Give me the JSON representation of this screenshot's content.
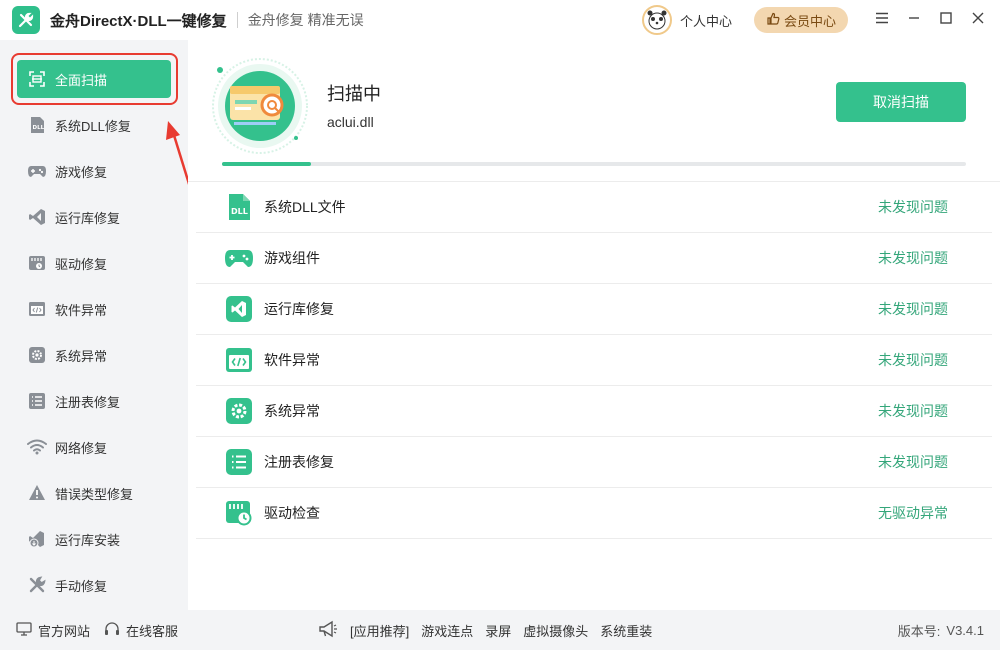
{
  "header": {
    "app_title": "金舟DirectX·DLL一键修复",
    "slogan": "金舟修复 精准无误",
    "personal_center": "个人中心",
    "vip_center": "会员中心",
    "logo_icon": "wrench-screwdriver-icon"
  },
  "sidebar": {
    "items": [
      {
        "label": "全面扫描",
        "icon": "scan-icon",
        "active": true
      },
      {
        "label": "系统DLL修复",
        "icon": "dll-icon"
      },
      {
        "label": "游戏修复",
        "icon": "gamepad-icon"
      },
      {
        "label": "运行库修复",
        "icon": "visual-studio-icon"
      },
      {
        "label": "驱动修复",
        "icon": "driver-icon"
      },
      {
        "label": "软件异常",
        "icon": "code-window-icon"
      },
      {
        "label": "系统异常",
        "icon": "gear-icon"
      },
      {
        "label": "注册表修复",
        "icon": "list-icon"
      },
      {
        "label": "网络修复",
        "icon": "wifi-icon"
      },
      {
        "label": "错误类型修复",
        "icon": "warning-icon"
      },
      {
        "label": "运行库安装",
        "icon": "install-icon"
      },
      {
        "label": "手动修复",
        "icon": "tools-icon"
      }
    ]
  },
  "scan": {
    "status": "扫描中",
    "current_file": "aclui.dll",
    "cancel_label": "取消扫描",
    "progress": 0.12
  },
  "results": [
    {
      "label": "系统DLL文件",
      "status": "未发现问题",
      "icon": "dll-icon"
    },
    {
      "label": "游戏组件",
      "status": "未发现问题",
      "icon": "gamepad-icon"
    },
    {
      "label": "运行库修复",
      "status": "未发现问题",
      "icon": "visual-studio-icon"
    },
    {
      "label": "软件异常",
      "status": "未发现问题",
      "icon": "code-window-icon"
    },
    {
      "label": "系统异常",
      "status": "未发现问题",
      "icon": "gear-icon"
    },
    {
      "label": "注册表修复",
      "status": "未发现问题",
      "icon": "list-icon"
    },
    {
      "label": "驱动检查",
      "status": "无驱动异常",
      "icon": "driver-icon"
    }
  ],
  "footer": {
    "official_site": "官方网站",
    "online_service": "在线客服",
    "app_recommend": "[应用推荐]",
    "promos": [
      "游戏连点",
      "录屏",
      "虚拟摄像头",
      "系统重装"
    ],
    "version_label": "版本号:",
    "version_value": "V3.4.1"
  },
  "colors": {
    "accent": "#34c18d",
    "status_ok": "#34a67a",
    "highlight": "#e83b31"
  }
}
